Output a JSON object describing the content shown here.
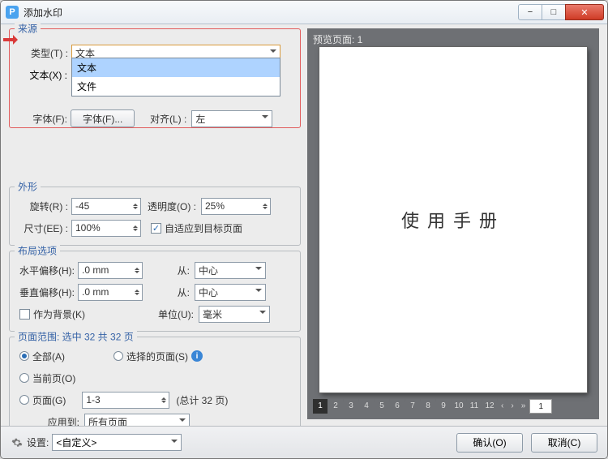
{
  "window": {
    "title": "添加水印",
    "icon_letter": "P"
  },
  "titlebar_buttons": {
    "min_tip": "−",
    "max_tip": "□",
    "close_tip": "✕"
  },
  "source": {
    "title": "来源",
    "type_label": "类型(T) :",
    "type_value": "文本",
    "type_options": [
      "文本",
      "文件"
    ],
    "text_label": "文本(X) :",
    "text_value": "",
    "font_label": "字体(F):",
    "font_button": "字体(F)...",
    "align_label": "对齐(L) :",
    "align_value": "左"
  },
  "appearance": {
    "title": "外形",
    "rotate_label": "旋转(R) :",
    "rotate_value": "-45",
    "opacity_label": "透明度(O) :",
    "opacity_value": "25%",
    "size_label": "尺寸(EE) :",
    "size_value": "100%",
    "fit_target_label": "自适应到目标页面"
  },
  "layout": {
    "title": "布局选项",
    "hoff_label": "水平偏移(H):",
    "hoff_value": ".0 mm",
    "hfrom_label": "从:",
    "hfrom_value": "中心",
    "voff_label": "垂直偏移(H):",
    "voff_value": ".0 mm",
    "vfrom_label": "从:",
    "vfrom_value": "中心",
    "as_bg_label": "作为背景(K)",
    "unit_label": "单位(U):",
    "unit_value": "毫米"
  },
  "range": {
    "title": "页面范围: 选中 32 共 32 页",
    "all_label": "全部(A)",
    "selected_label": "选择的页面(S)",
    "current_label": "当前页(O)",
    "page_label": "页面(G)",
    "page_value": "1-3",
    "total_note": "(总计 32 页)",
    "apply_to_label": "应用到:",
    "apply_to_value": "所有页面"
  },
  "preview": {
    "title": "预览页面: 1",
    "watermark_text": "使用手册",
    "pages": [
      "1",
      "2",
      "3",
      "4",
      "5",
      "6",
      "7",
      "8",
      "9",
      "10",
      "11",
      "12"
    ],
    "current_page": "1",
    "page_input": "1"
  },
  "footer": {
    "settings_label": "设置:",
    "settings_value": "<自定义>",
    "ok_label": "确认(O)",
    "cancel_label": "取消(C)"
  }
}
